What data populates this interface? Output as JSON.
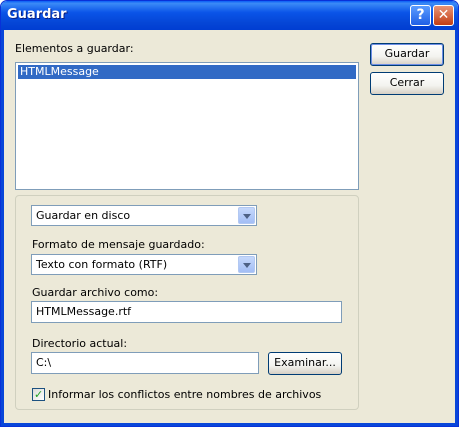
{
  "window": {
    "title": "Guardar",
    "help_glyph": "?",
    "close_glyph": "✕"
  },
  "items_label": "Elementos a guardar:",
  "items": [
    "HTMLMessage"
  ],
  "buttons": {
    "save": "Guardar",
    "close": "Cerrar",
    "browse": "Examinar..."
  },
  "save_destination": {
    "selected": "Guardar en disco"
  },
  "format": {
    "label": "Formato de mensaje guardado:",
    "selected": "Texto con formato (RTF)"
  },
  "filename": {
    "label": "Guardar archivo como:",
    "value": "HTMLMessage.rtf"
  },
  "directory": {
    "label": "Directorio actual:",
    "value": "C:\\"
  },
  "report_conflicts": {
    "label": "Informar los conflictos entre nombres de archivos",
    "checked": true,
    "mark": "✓"
  }
}
